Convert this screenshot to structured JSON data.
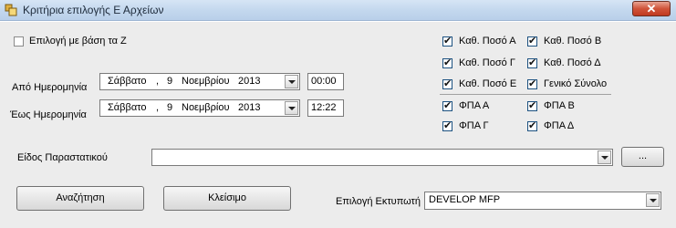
{
  "window": {
    "title": "Κριτήρια επιλογής Ε  Αρχείων",
    "close_symbol": "✕"
  },
  "filters": {
    "z_based_label": "Επιλογή με βάση τα Ζ",
    "z_based_checked": false,
    "from_date_label": "Από Ημερομηνία",
    "from_date": {
      "weekday": "Σάββατο",
      "day": "9",
      "month": "Νοεμβρίου",
      "year": "2013"
    },
    "from_time": "00:00",
    "to_date_label": "Έως Ημερομηνία",
    "to_date": {
      "weekday": "Σάββατο",
      "day": "9",
      "month": "Νοεμβρίου",
      "year": "2013"
    },
    "to_time": "12:22",
    "date_separator": ","
  },
  "columns": {
    "amounts": [
      {
        "label": "Καθ. Ποσό Α",
        "checked": true
      },
      {
        "label": "Καθ. Ποσό Β",
        "checked": true
      },
      {
        "label": "Καθ. Ποσό Γ",
        "checked": true
      },
      {
        "label": "Καθ. Ποσό Δ",
        "checked": true
      },
      {
        "label": "Καθ. Ποσό Ε",
        "checked": true
      },
      {
        "label": "Γενικό Σύνολο",
        "checked": true
      }
    ],
    "vat": [
      {
        "label": "ΦΠΑ Α",
        "checked": true
      },
      {
        "label": "ΦΠΑ Β",
        "checked": true
      },
      {
        "label": "ΦΠΑ Γ",
        "checked": true
      },
      {
        "label": "ΦΠΑ Δ",
        "checked": true
      }
    ]
  },
  "document_type": {
    "label": "Είδος Παραστατικού",
    "value": "",
    "browse_label": "..."
  },
  "actions": {
    "search_label": "Αναζήτηση",
    "close_label": "Κλείσιμο"
  },
  "printer": {
    "label": "Επιλογή Εκτυπωτή",
    "value": "DEVELOP MFP"
  },
  "icons": {
    "app": "app-window-icon",
    "dropdown": "chevron-down-icon",
    "check": "check-icon"
  }
}
